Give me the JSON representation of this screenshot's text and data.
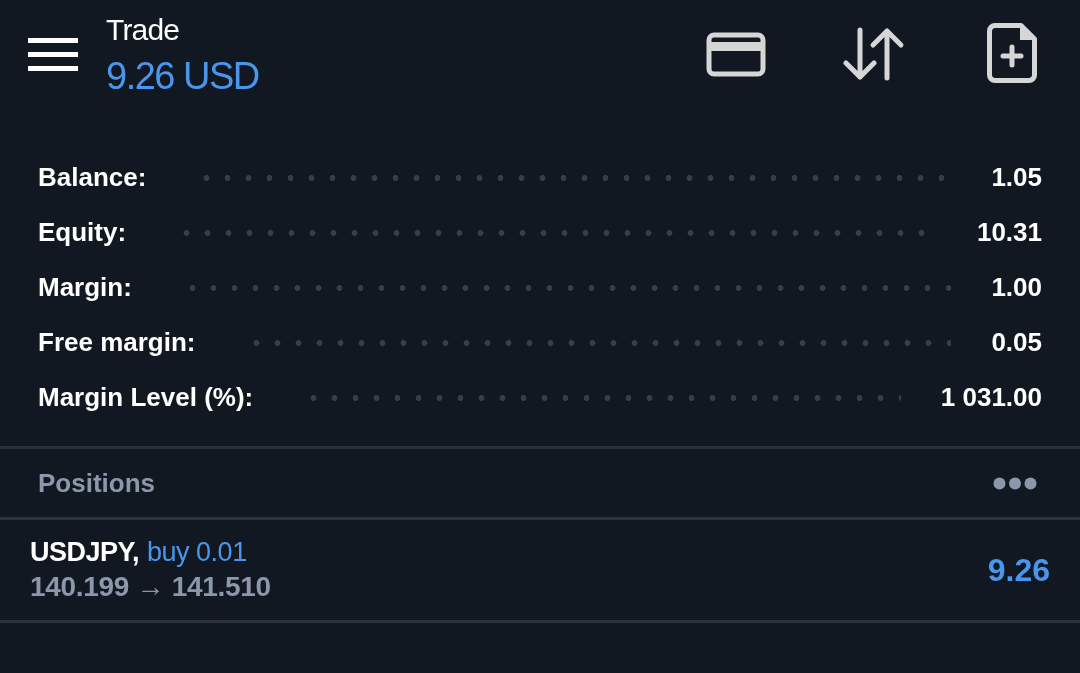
{
  "header": {
    "title": "Trade",
    "profit": "9.26 USD"
  },
  "account": [
    {
      "label": "Balance:",
      "value": "1.05"
    },
    {
      "label": "Equity:",
      "value": "10.31"
    },
    {
      "label": "Margin:",
      "value": "1.00"
    },
    {
      "label": "Free margin:",
      "value": "0.05"
    },
    {
      "label": "Margin Level (%):",
      "value": "1 031.00"
    }
  ],
  "positions": {
    "title": "Positions",
    "items": [
      {
        "symbol": "USDJPY,",
        "order": "buy 0.01",
        "prices": "140.199 → 141.510",
        "profit": "9.26"
      }
    ]
  }
}
